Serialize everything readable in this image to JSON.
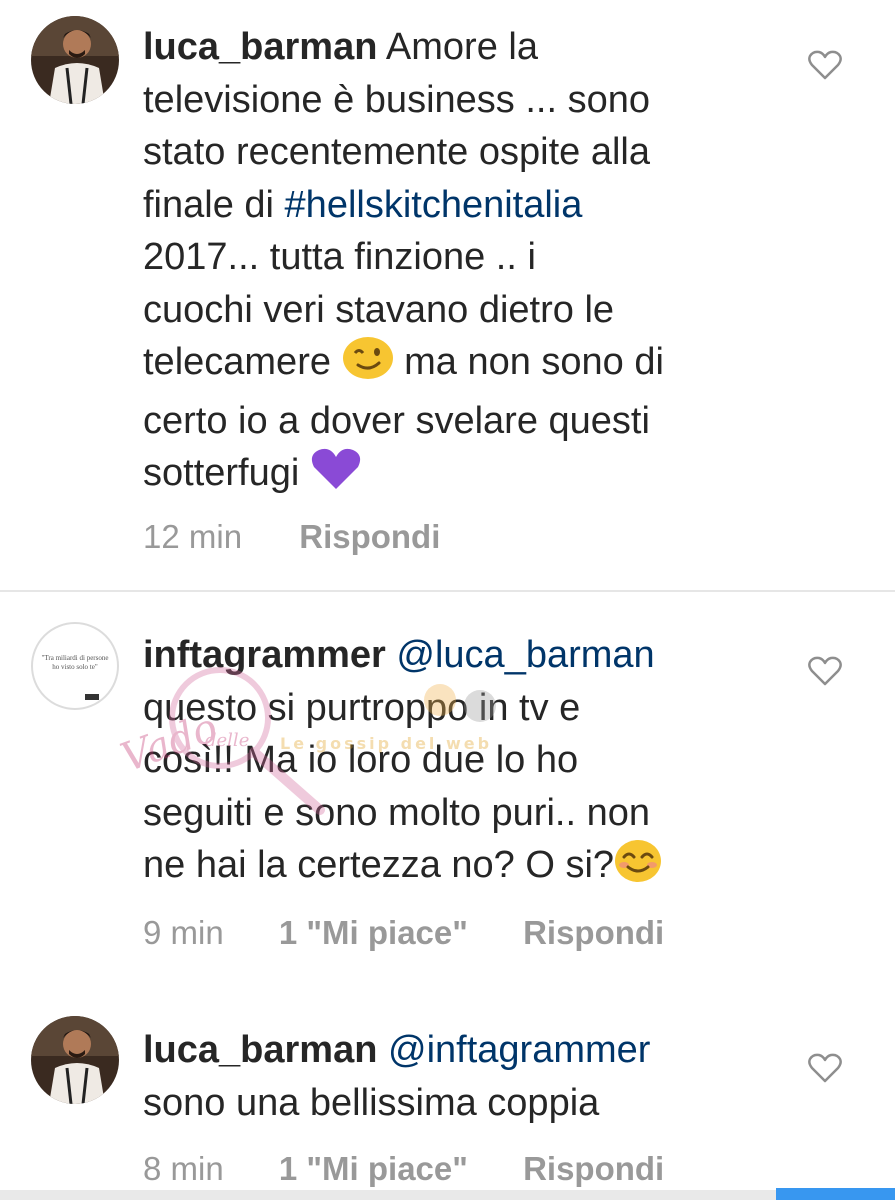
{
  "comments": [
    {
      "username": "luca_barman",
      "text_lines": [
        "Amore la",
        "televisione è  business ... sono",
        "stato recentemente ospite alla",
        "finale di ",
        "#hellskitchenitalia",
        "2017... tutta finzione .. i",
        "cuochi veri stavano dietro le",
        "telecamere ",
        " ma non sono di",
        "certo io a dover svelare questi",
        "sotterfugi "
      ],
      "time": "12 min",
      "reply": "Rispondi",
      "avatar_icon": "man-photo-avatar",
      "emoji_1": "wink-emoji",
      "emoji_2": "purple-heart-emoji"
    },
    {
      "username": "inftagrammer",
      "mention": "@luca_barman",
      "text_lines": [
        "questo si purtroppo in tv e",
        "così!! Ma io loro due lo ho",
        "seguiti e sono molto puri.. non",
        "ne hai la certezza no? O si?"
      ],
      "time": "9 min",
      "likes": "1 \"Mi piace\"",
      "reply": "Rispondi",
      "avatar_quote": "\"Tra miliardi di persone ho visto solo te\"",
      "emoji_1": "blush-smile-emoji"
    },
    {
      "username": "luca_barman",
      "mention": "@inftagrammer",
      "text_lines": [
        "sono una bellissima coppia"
      ],
      "time": "8 min",
      "likes": "1 \"Mi piace\"",
      "reply": "Rispondi",
      "avatar_icon": "man-photo-avatar"
    }
  ],
  "watermark": {
    "text_1": "Vado",
    "text_2": "delle",
    "text_3": "Le gossip del web"
  },
  "colors": {
    "text": "#262626",
    "meta": "#999999",
    "hashtag": "#003569",
    "heart_outline": "#8e8e8e",
    "divider": "#e6e6e6",
    "purple_heart": "#8a4ad6",
    "emoji_yellow": "#f7c531"
  }
}
